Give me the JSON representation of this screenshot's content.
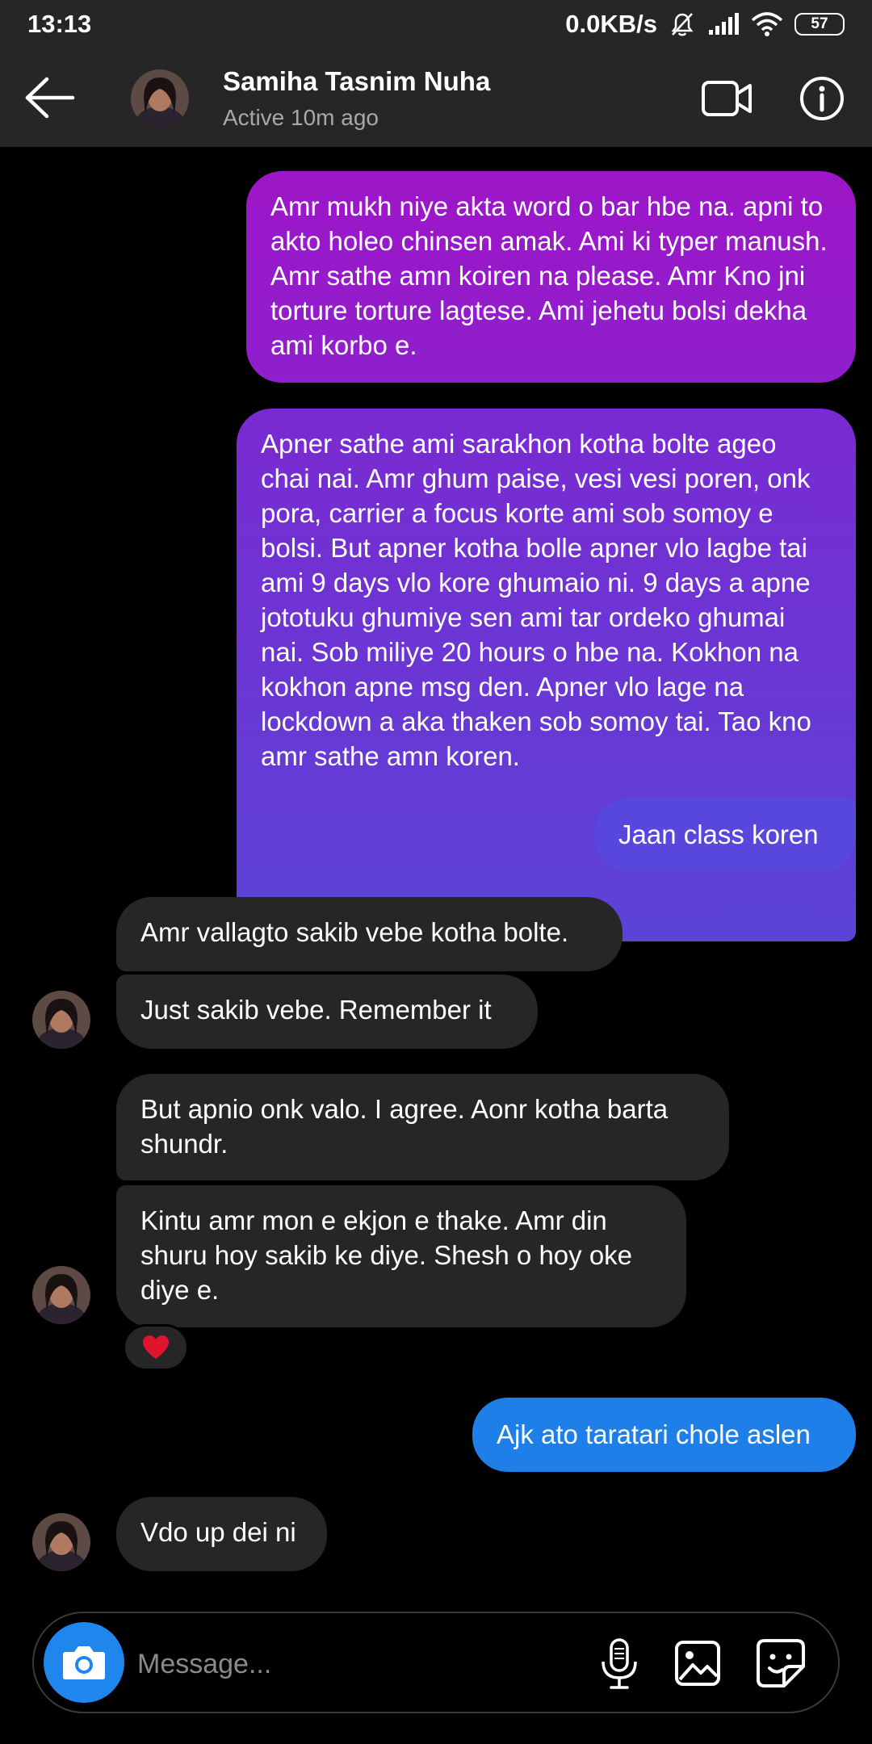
{
  "status_bar": {
    "time": "13:13",
    "network_speed": "0.0KB/s",
    "battery": "57"
  },
  "header": {
    "contact_name": "Samiha Tasnim Nuha",
    "contact_status": "Active 10m ago"
  },
  "messages": [
    {
      "direction": "out",
      "text": "Amr mukh niye akta word o bar hbe na. apni to akto holeo chinsen amak. Ami ki typer manush. Amr sathe amn koiren na please. Amr Kno jni torture torture lagtese. Ami jehetu bolsi dekha ami korbo e."
    },
    {
      "direction": "out",
      "text": "Apner sathe ami sarakhon kotha bolte ageo chai nai. Amr ghum paise, vesi vesi poren, onk pora, carrier a focus korte ami sob somoy e bolsi. But apner kotha bolle apner vlo lagbe tai ami 9 days vlo kore ghumaio ni. 9 days a apne jototuku ghumiye sen ami tar ordeko ghumai nai. Sob miliye 20 hours o hbe na. Kokhon na kokhon apne msg den. Apner vlo lage na lockdown a aka thaken sob somoy tai. Tao kno amr sathe amn koren."
    },
    {
      "direction": "out",
      "text": "Jaan class koren"
    },
    {
      "direction": "in",
      "text": "Amr vallagto sakib vebe kotha bolte."
    },
    {
      "direction": "in",
      "text": "Just sakib vebe. Remember it"
    },
    {
      "direction": "in",
      "text": "But apnio onk valo. I agree. Aonr kotha barta shundr."
    },
    {
      "direction": "in",
      "text": "Kintu amr mon e ekjon e thake. Amr din shuru hoy sakib ke diye. Shesh o hoy oke diye e."
    },
    {
      "direction": "out",
      "text": "Ajk ato taratari chole aslen"
    },
    {
      "direction": "in",
      "text": "Vdo up dei ni"
    }
  ],
  "reaction": {
    "icon": "heart-icon",
    "color": "#e0142c"
  },
  "composer": {
    "placeholder": "Message..."
  },
  "colors": {
    "outgoing_purple": "#9d16c8",
    "outgoing_violet": "#5b43d6",
    "outgoing_blue": "#1f7fe8",
    "incoming": "#262626",
    "camera_button": "#1f86ee"
  }
}
